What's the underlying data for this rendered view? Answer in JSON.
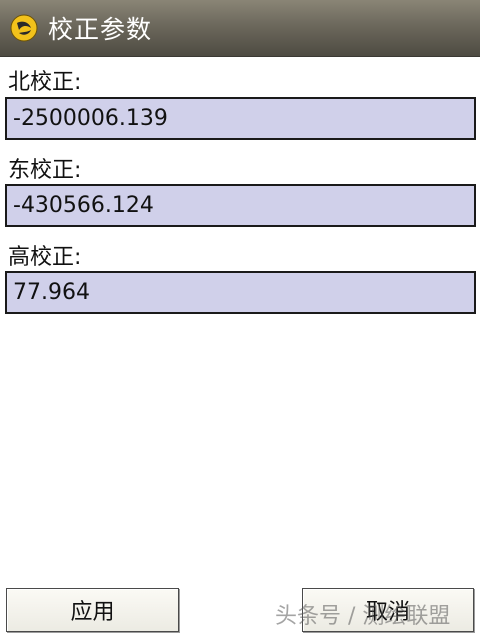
{
  "window": {
    "title": "校正参数",
    "icon": "app-logo-icon"
  },
  "fields": [
    {
      "label": "北校正:",
      "value": "-2500006.139"
    },
    {
      "label": "东校正:",
      "value": "-430566.124"
    },
    {
      "label": "高校正:",
      "value": "77.964"
    }
  ],
  "buttons": {
    "apply_label": "应用",
    "cancel_label": "取消"
  },
  "watermark": "头条号 / 测绘联盟",
  "colors": {
    "input_background": "#d0d0ea",
    "titlebar": "#6c685c"
  }
}
